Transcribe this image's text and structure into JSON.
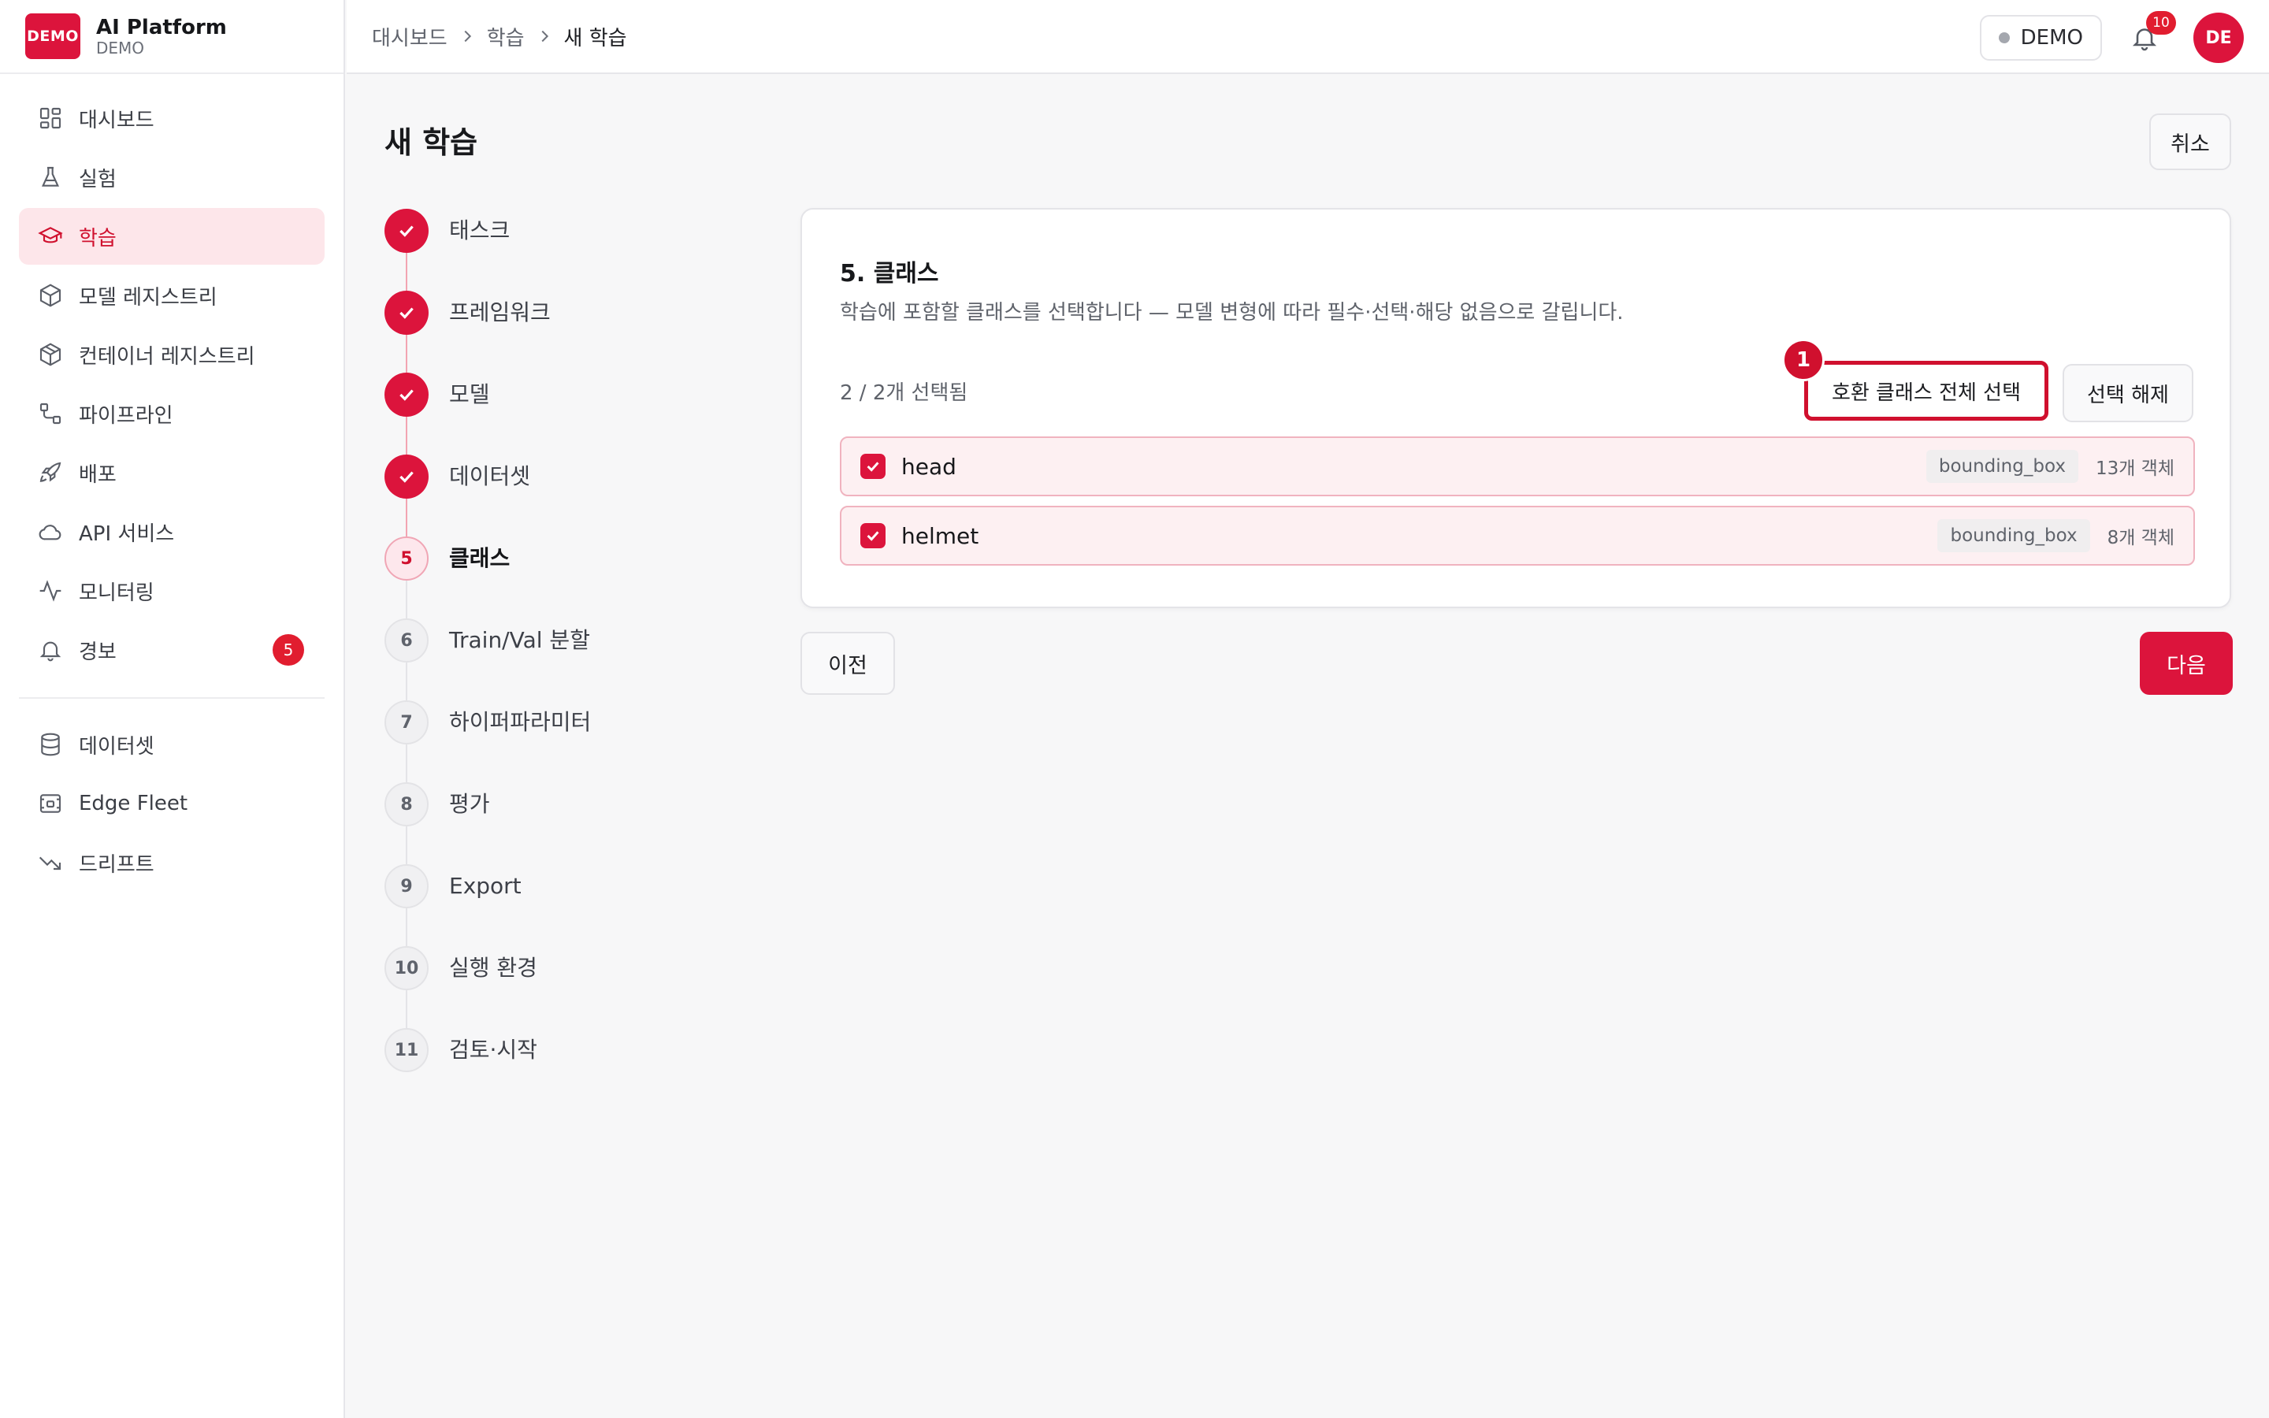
{
  "brand": {
    "logo_text": "DEMO",
    "title": "AI Platform",
    "subtitle": "DEMO"
  },
  "sidebar": {
    "items": [
      {
        "label": "대시보드",
        "icon": "dashboard-icon"
      },
      {
        "label": "실험",
        "icon": "flask-icon"
      },
      {
        "label": "학습",
        "icon": "graduation-cap-icon",
        "active": true
      },
      {
        "label": "모델 레지스트리",
        "icon": "cube-icon"
      },
      {
        "label": "컨테이너 레지스트리",
        "icon": "package-icon"
      },
      {
        "label": "파이프라인",
        "icon": "pipeline-icon"
      },
      {
        "label": "배포",
        "icon": "rocket-icon"
      },
      {
        "label": "API 서비스",
        "icon": "cloud-icon"
      },
      {
        "label": "모니터링",
        "icon": "activity-icon"
      },
      {
        "label": "경보",
        "icon": "bell-icon",
        "badge": "5"
      }
    ],
    "secondary_items": [
      {
        "label": "데이터셋",
        "icon": "database-icon"
      },
      {
        "label": "Edge Fleet",
        "icon": "edge-device-icon"
      },
      {
        "label": "드리프트",
        "icon": "trending-down-icon"
      }
    ]
  },
  "header": {
    "breadcrumb": [
      "대시보드",
      "학습",
      "새 학습"
    ],
    "env_label": "DEMO",
    "notification_count": "10",
    "avatar_initials": "DE"
  },
  "page": {
    "title": "새 학습",
    "cancel_label": "취소"
  },
  "steps": [
    {
      "number": "1",
      "label": "태스크",
      "status": "done"
    },
    {
      "number": "2",
      "label": "프레임워크",
      "status": "done"
    },
    {
      "number": "3",
      "label": "모델",
      "status": "done"
    },
    {
      "number": "4",
      "label": "데이터셋",
      "status": "done"
    },
    {
      "number": "5",
      "label": "클래스",
      "status": "current"
    },
    {
      "number": "6",
      "label": "Train/Val 분할",
      "status": "todo"
    },
    {
      "number": "7",
      "label": "하이퍼파라미터",
      "status": "todo"
    },
    {
      "number": "8",
      "label": "평가",
      "status": "todo"
    },
    {
      "number": "9",
      "label": "Export",
      "status": "todo"
    },
    {
      "number": "10",
      "label": "실행 환경",
      "status": "todo"
    },
    {
      "number": "11",
      "label": "검토·시작",
      "status": "todo"
    }
  ],
  "classes_step": {
    "title": "5. 클래스",
    "description": "학습에 포함할 클래스를 선택합니다 — 모델 변형에 따라 필수·선택·해당 없음으로 갈립니다.",
    "selection_count": "2 / 2개 선택됨",
    "select_all_label": "호환 클래스 전체 선택",
    "deselect_label": "선택 해제",
    "callout_number": "1",
    "classes": [
      {
        "name": "head",
        "type": "bounding_box",
        "count": "13개 객체",
        "checked": true
      },
      {
        "name": "helmet",
        "type": "bounding_box",
        "count": "8개 객체",
        "checked": true
      }
    ]
  },
  "footer": {
    "prev_label": "이전",
    "next_label": "다음"
  },
  "colors": {
    "accent": "#dc143c",
    "accent_light": "#fde6ea",
    "badge": "#e11d2f"
  }
}
